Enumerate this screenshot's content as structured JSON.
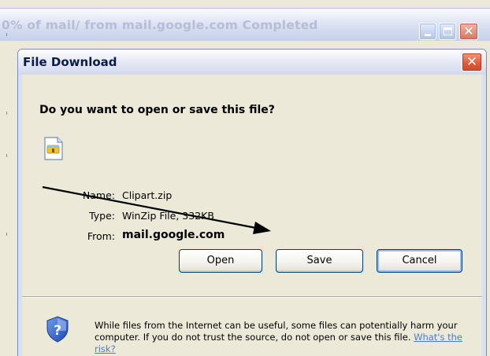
{
  "outer_window": {
    "title": "0% of mail/ from mail.google.com Completed"
  },
  "dialog": {
    "title": "File Download",
    "question": "Do you want to open or save this file?",
    "file": {
      "name_label": "Name:",
      "name_value": "Clipart.zip",
      "type_label": "Type:",
      "type_value": "WinZip File, 332KB",
      "from_label": "From:",
      "from_value": "mail.google.com"
    },
    "buttons": {
      "open": "Open",
      "save": "Save",
      "cancel": "Cancel"
    },
    "warning": {
      "text": "While files from the Internet can be useful, some files can potentially harm your computer. If you do not trust the source, do not open or save this file.",
      "link": "What's the risk?"
    }
  },
  "icons": {
    "file_icon": "zip-file-icon",
    "security_icon": "shield-question-icon",
    "callout": "arrow-pointing-to-save"
  }
}
